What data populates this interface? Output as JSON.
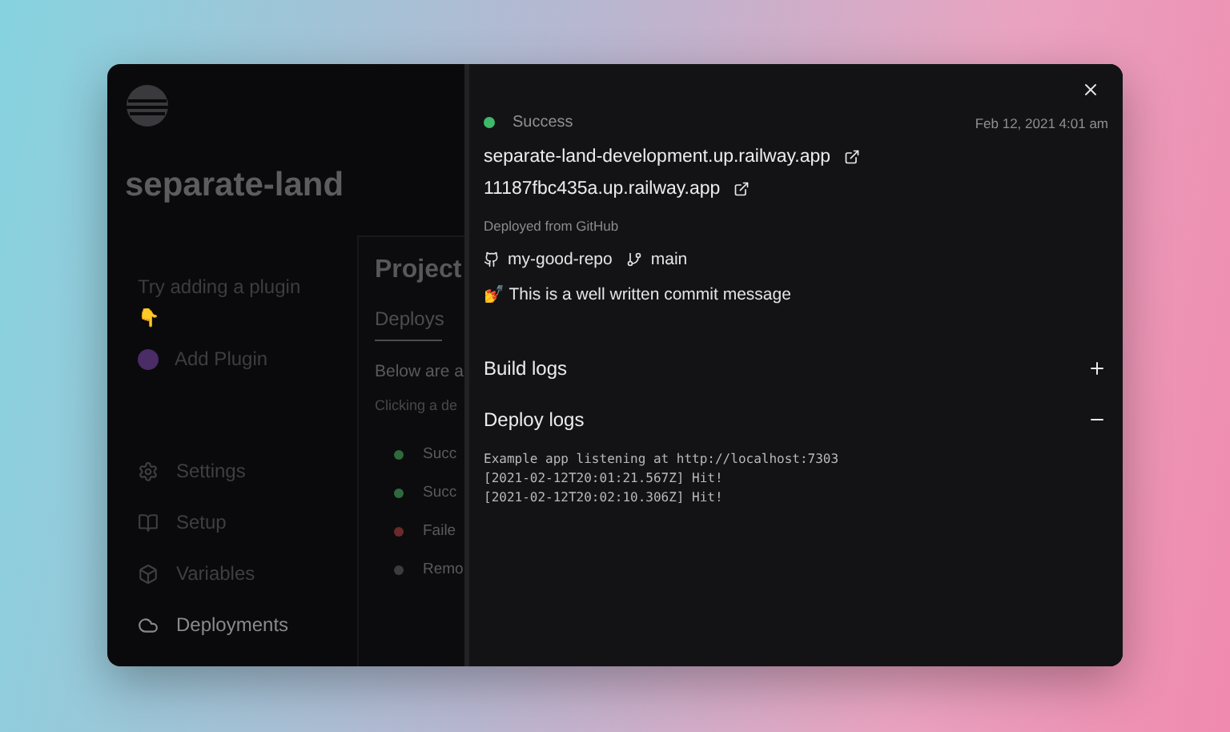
{
  "project": {
    "title": "separate-land",
    "plugin_hint": "Try adding a plugin",
    "plugin_emoji": "👇",
    "add_plugin": "Add Plugin"
  },
  "sidebar": {
    "items": [
      {
        "label": "Settings",
        "selected": false
      },
      {
        "label": "Setup",
        "selected": false
      },
      {
        "label": "Variables",
        "selected": false
      },
      {
        "label": "Deployments",
        "selected": true
      }
    ]
  },
  "content": {
    "title": "Project",
    "tabs": [
      {
        "label": "Deploys",
        "selected": true
      }
    ],
    "intro": "Below are a",
    "hint": "Clicking a de",
    "deploys": [
      {
        "status": "Succ",
        "color": "#2e6a3e"
      },
      {
        "status": "Succ",
        "color": "#2e6a3e"
      },
      {
        "status": "Faile",
        "color": "#6a2a2a"
      },
      {
        "status": "Remo",
        "color": "#3c3c40"
      }
    ]
  },
  "drawer": {
    "status": {
      "label": "Success",
      "color": "#3fb86a"
    },
    "date": "Feb 12, 2021 4:01 am",
    "urls": [
      "separate-land-development.up.railway.app",
      "11187fbc435a.up.railway.app"
    ],
    "source_label": "Deployed from GitHub",
    "repo": "my-good-repo",
    "branch": "main",
    "commit": "💅 This is a well written commit message",
    "sections": [
      {
        "title": "Build logs",
        "expanded": false
      },
      {
        "title": "Deploy logs",
        "expanded": true,
        "lines": [
          "Example app listening at http://localhost:7303",
          "[2021-02-12T20:01:21.567Z] Hit!",
          "[2021-02-12T20:02:10.306Z] Hit!"
        ]
      }
    ]
  }
}
